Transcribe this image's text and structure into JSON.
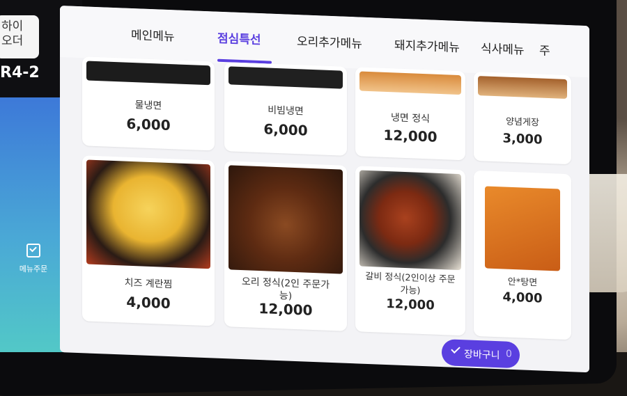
{
  "brand": {
    "logo_line1": "하이",
    "logo_line2": "오더",
    "table_no": "R4-2"
  },
  "sidebar": {
    "menu_order_label": "메뉴주문"
  },
  "tabs": [
    {
      "label": "메인메뉴",
      "active": false
    },
    {
      "label": "점심특선",
      "active": true
    },
    {
      "label": "오리추가메뉴",
      "active": false
    },
    {
      "label": "돼지추가메뉴",
      "active": false
    },
    {
      "label": "식사메뉴",
      "active": false
    },
    {
      "label": "주",
      "active": false
    }
  ],
  "next_icon": "chevron-right-icon",
  "menu_items": [
    {
      "name": "물냉면",
      "price": "6,000"
    },
    {
      "name": "비빔냉면",
      "price": "6,000"
    },
    {
      "name": "냉면 정식",
      "price": "12,000"
    },
    {
      "name": "양념게장",
      "price": "3,000"
    },
    {
      "name": "치즈 계란찜",
      "price": "4,000"
    },
    {
      "name": "오리 정식(2인 주문가능)",
      "price": "12,000"
    },
    {
      "name": "갈비 정식(2인이상 주문가능)",
      "price": "12,000"
    },
    {
      "name": "안*탕면",
      "price": "4,000"
    }
  ],
  "cart": {
    "label": "장바구니",
    "count": "0"
  },
  "colors": {
    "accent": "#5a3fe0",
    "sidebar_gradient_top": "#3d79d8",
    "sidebar_gradient_bottom": "#52c8c7"
  }
}
